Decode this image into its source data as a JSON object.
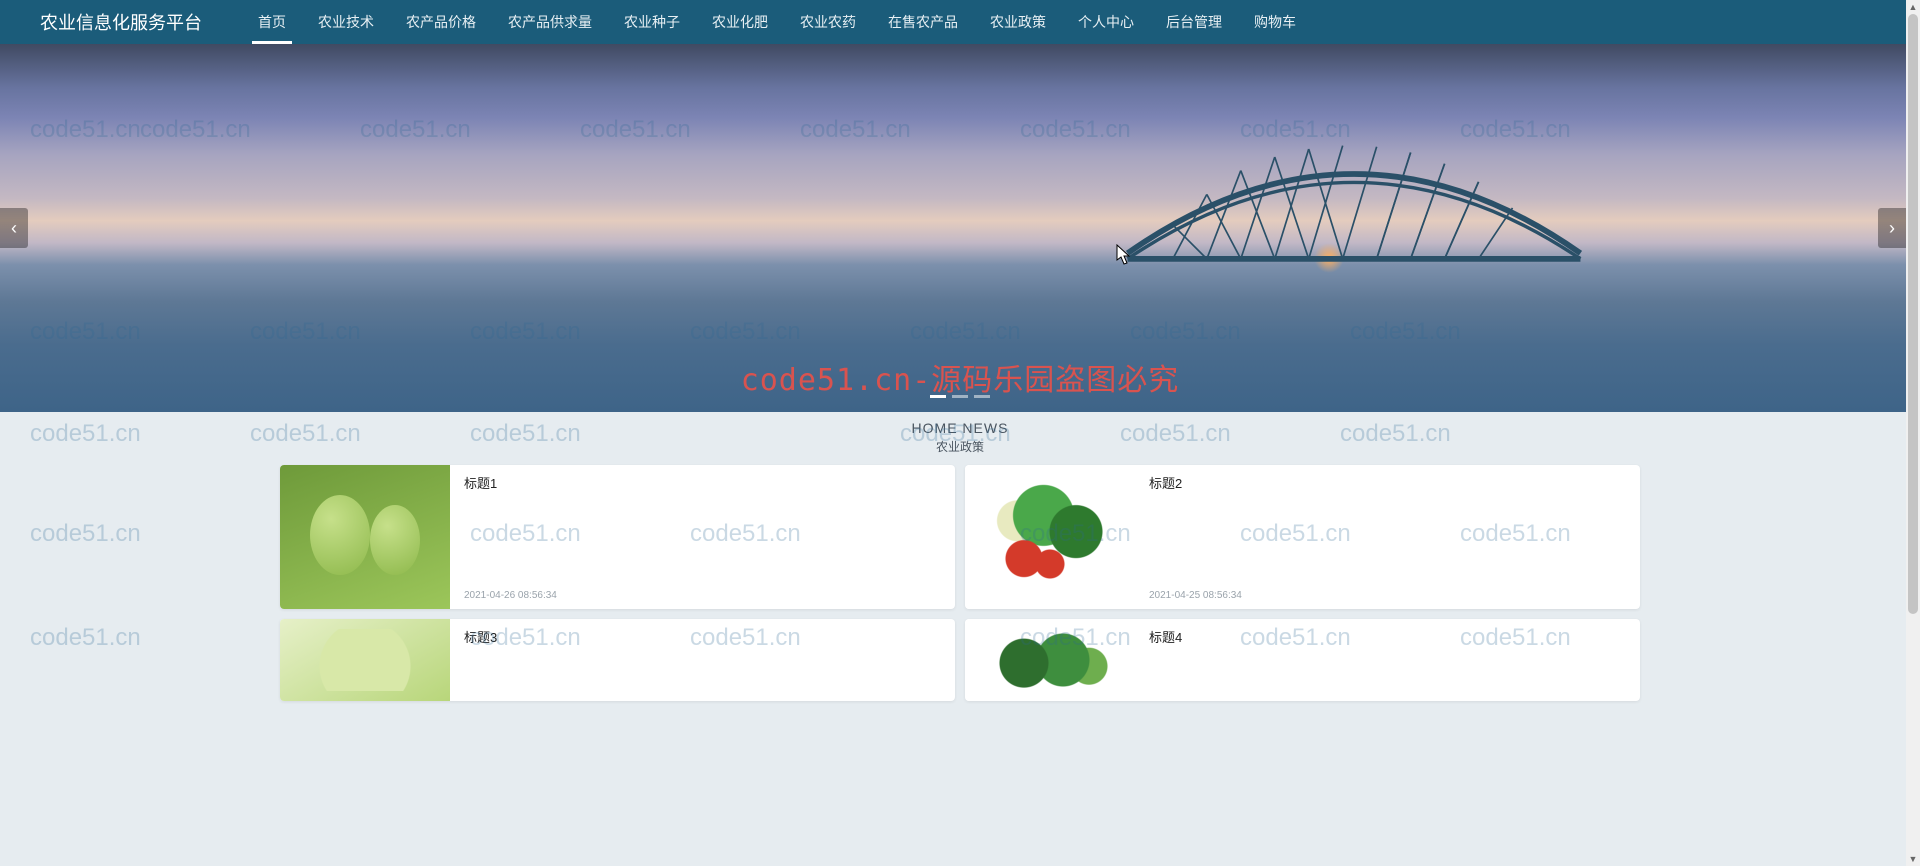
{
  "brand": "农业信息化服务平台",
  "nav": [
    {
      "label": "首页",
      "active": true
    },
    {
      "label": "农业技术",
      "active": false
    },
    {
      "label": "农产品价格",
      "active": false
    },
    {
      "label": "农产品供求量",
      "active": false
    },
    {
      "label": "农业种子",
      "active": false
    },
    {
      "label": "农业化肥",
      "active": false
    },
    {
      "label": "农业农药",
      "active": false
    },
    {
      "label": "在售农产品",
      "active": false
    },
    {
      "label": "农业政策",
      "active": false
    },
    {
      "label": "个人中心",
      "active": false
    },
    {
      "label": "后台管理",
      "active": false
    },
    {
      "label": "购物车",
      "active": false
    }
  ],
  "banner": {
    "prev_glyph": "‹",
    "next_glyph": "›",
    "dot_count": 3,
    "active_dot": 0
  },
  "watermark_text": "code51.cn",
  "watermark_center": "code51.cn-源码乐园盗图必究",
  "section": {
    "en": "HOME NEWS",
    "zh": "农业政策"
  },
  "cards": [
    {
      "title": "标题1",
      "date": "2021-04-26 08:56:34",
      "img": "veg-1",
      "short": false
    },
    {
      "title": "标题2",
      "date": "2021-04-25 08:56:34",
      "img": "veg-2",
      "short": false
    },
    {
      "title": "标题3",
      "date": "",
      "img": "veg-3",
      "short": true
    },
    {
      "title": "标题4",
      "date": "",
      "img": "veg-4",
      "short": true
    }
  ]
}
